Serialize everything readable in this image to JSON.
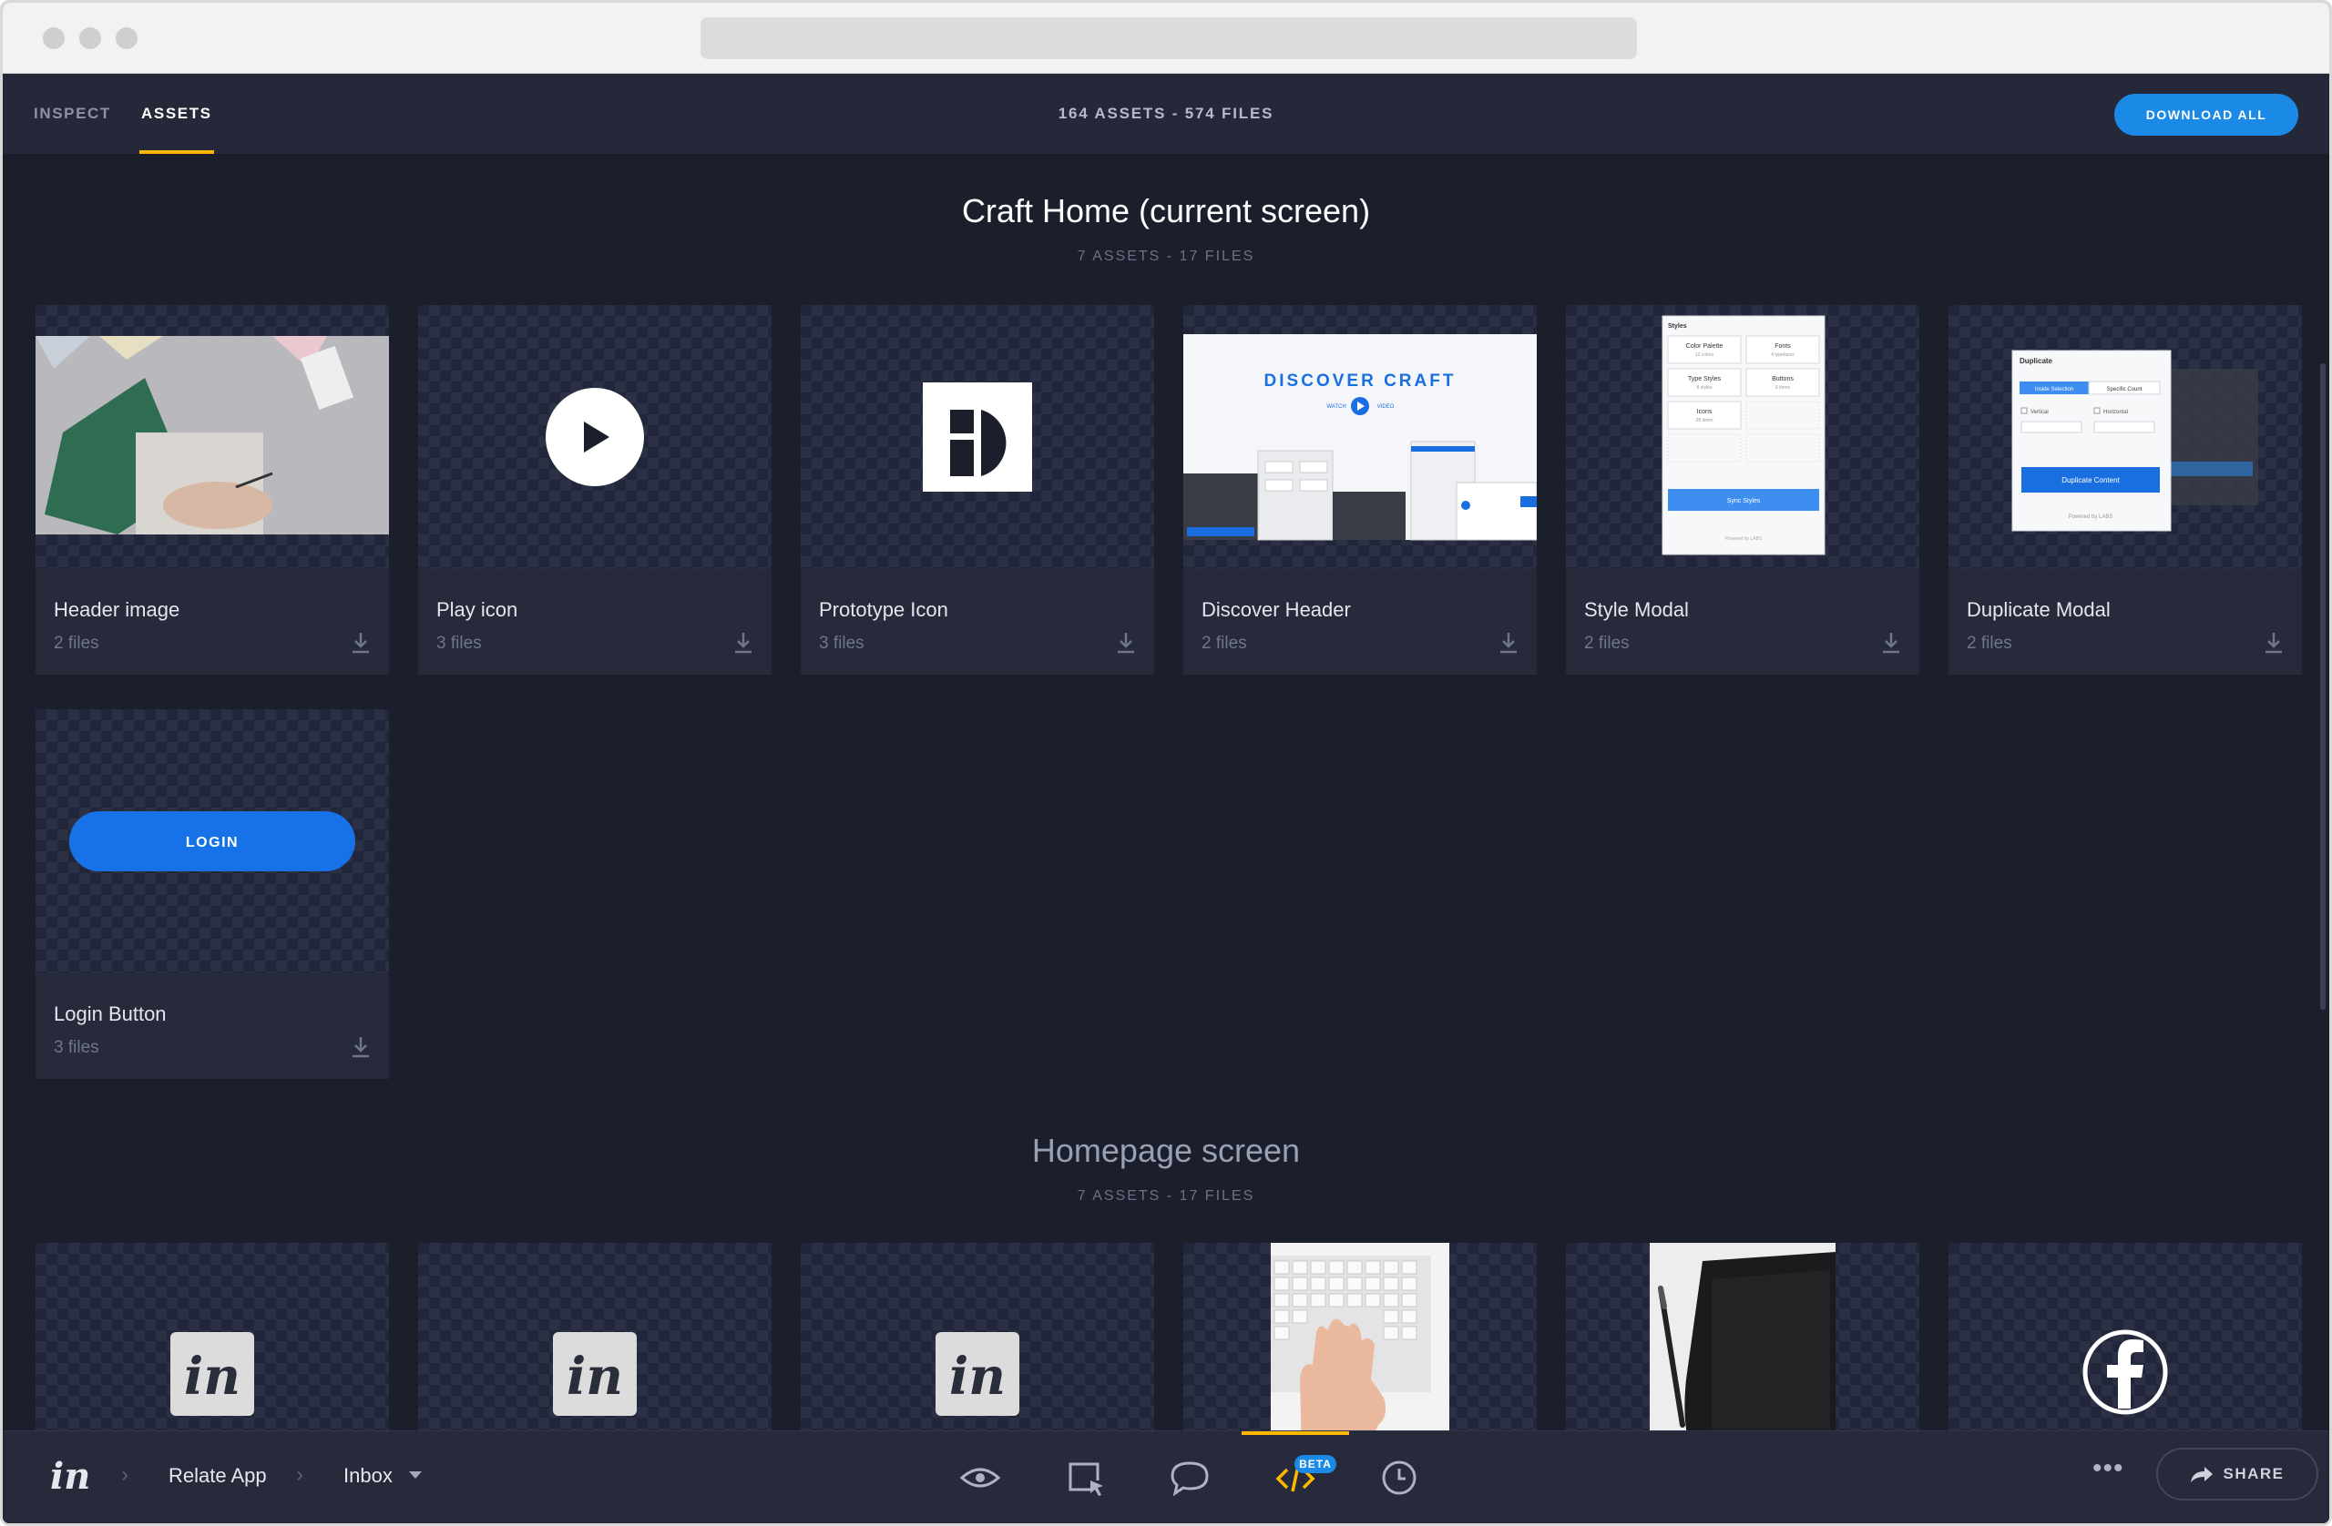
{
  "browser": {
    "traffic_lights": [
      "close",
      "minimize",
      "maximize"
    ]
  },
  "topnav": {
    "tabs": [
      {
        "label": "INSPECT",
        "active": false
      },
      {
        "label": "ASSETS",
        "active": true
      }
    ],
    "counts": "164 ASSETS - 574 FILES",
    "download_all": "DOWNLOAD ALL",
    "accent_color": "#ffb800",
    "button_color": "#1a8ae6"
  },
  "sections": [
    {
      "title": "Craft Home (current screen)",
      "subtitle": "7 ASSETS - 17 FILES",
      "assets": [
        {
          "name": "Header image",
          "files": "2 files",
          "thumb": "photo-desk"
        },
        {
          "name": "Play icon",
          "files": "3 files",
          "thumb": "play-icon"
        },
        {
          "name": "Prototype Icon",
          "files": "3 files",
          "thumb": "prototype-icon"
        },
        {
          "name": "Discover Header",
          "files": "2 files",
          "thumb": "discover-craft"
        },
        {
          "name": "Style Modal",
          "files": "2 files",
          "thumb": "style-modal"
        },
        {
          "name": "Duplicate Modal",
          "files": "2 files",
          "thumb": "duplicate-modal"
        },
        {
          "name": "Login Button",
          "files": "3 files",
          "thumb": "login-button"
        }
      ],
      "previews": {
        "discover": {
          "title": "DISCOVER CRAFT",
          "watch": "WATCH",
          "video": "VIDEO"
        },
        "style_modal": {
          "title": "Styles",
          "cells": [
            {
              "label": "Color Palette",
              "sub": "12 colors"
            },
            {
              "label": "Fonts",
              "sub": "4 typefaces"
            },
            {
              "label": "Type Styles",
              "sub": "8 styles"
            },
            {
              "label": "Buttons",
              "sub": "6 items"
            },
            {
              "label": "Icons",
              "sub": "28 items"
            }
          ],
          "button": "Sync Styles",
          "footer": "Powered by LABS"
        },
        "duplicate_modal": {
          "title": "Duplicate",
          "tabs": [
            "Inside Selection",
            "Specific Count"
          ],
          "options": [
            "Vertical",
            "Horizontal"
          ],
          "button": "Duplicate Content",
          "footer": "Powered by LABS"
        },
        "login_label": "LOGIN"
      }
    },
    {
      "title": "Homepage screen",
      "subtitle": "7 ASSETS - 17 FILES",
      "assets": [
        {
          "thumb": "invision-logo"
        },
        {
          "thumb": "invision-logo"
        },
        {
          "thumb": "invision-logo"
        },
        {
          "thumb": "keyboard-photo"
        },
        {
          "thumb": "tablet-photo"
        },
        {
          "thumb": "facebook-icon"
        }
      ],
      "logo_text": "in"
    }
  ],
  "bottombar": {
    "logo": "in",
    "breadcrumb": [
      "Relate App",
      "Inbox"
    ],
    "tools": [
      "preview-icon",
      "build-icon",
      "comment-icon",
      "inspect-icon",
      "history-icon"
    ],
    "beta_badge": "BETA",
    "share": "SHARE"
  }
}
